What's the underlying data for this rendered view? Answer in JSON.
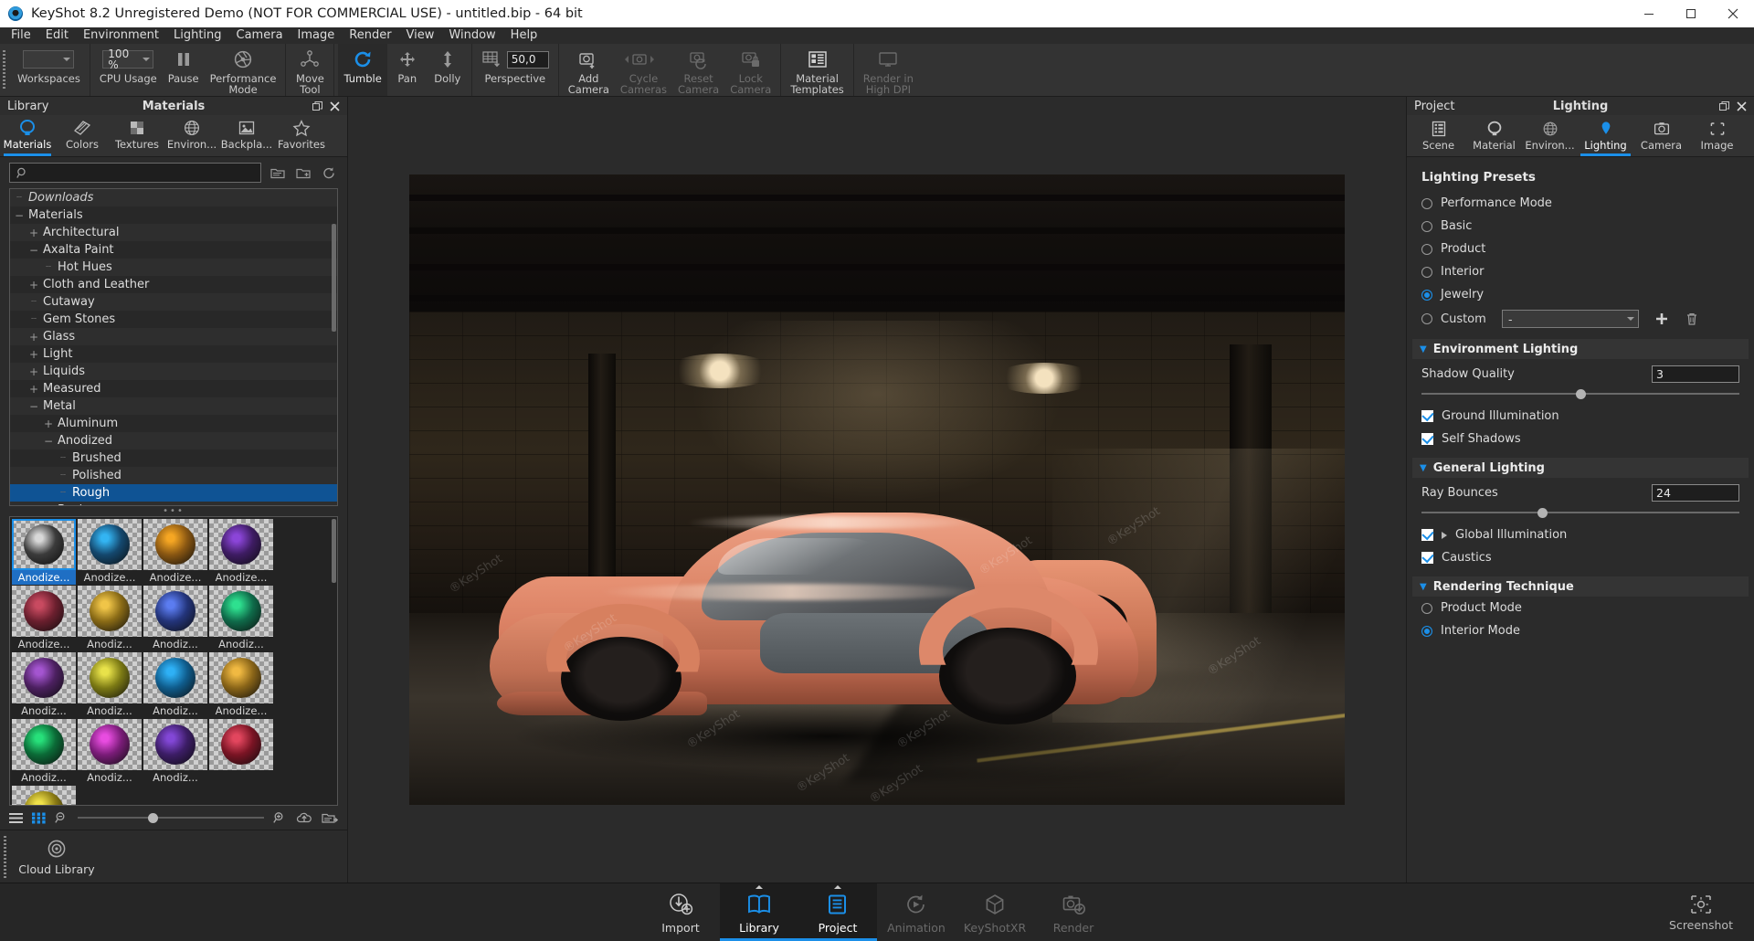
{
  "window": {
    "title": "KeyShot 8.2 Unregistered Demo (NOT FOR COMMERCIAL USE) - untitled.bip  - 64 bit",
    "minimize_label": "Minimize",
    "maximize_label": "Restore",
    "close_label": "Close"
  },
  "menubar": [
    {
      "label": "File"
    },
    {
      "label": "Edit"
    },
    {
      "label": "Environment"
    },
    {
      "label": "Lighting"
    },
    {
      "label": "Camera"
    },
    {
      "label": "Image"
    },
    {
      "label": "Render"
    },
    {
      "label": "View"
    },
    {
      "label": "Window"
    },
    {
      "label": "Help"
    }
  ],
  "ribbon": {
    "workspaces": {
      "label": "Workspaces",
      "value": ""
    },
    "cpu_usage": {
      "label": "CPU Usage",
      "value": "100 %"
    },
    "pause": {
      "label": "Pause"
    },
    "performance_mode": {
      "label": "Performance\nMode"
    },
    "move_tool": {
      "label": "Move\nTool"
    },
    "tumble": {
      "label": "Tumble"
    },
    "pan": {
      "label": "Pan"
    },
    "dolly": {
      "label": "Dolly"
    },
    "perspective": {
      "label": "Perspective",
      "value": "50,0"
    },
    "add_camera": {
      "label": "Add\nCamera"
    },
    "cycle_cameras": {
      "label": "Cycle\nCameras"
    },
    "reset_camera": {
      "label": "Reset\nCamera"
    },
    "lock_camera": {
      "label": "Lock\nCamera"
    },
    "material_templates": {
      "label": "Material\nTemplates"
    },
    "render_in_high_dpi": {
      "label": "Render in\nHigh DPI"
    }
  },
  "library": {
    "header_left": "Library",
    "header_title": "Materials",
    "tabs": [
      {
        "label": "Materials",
        "icon": "materials-icon",
        "active": true
      },
      {
        "label": "Colors",
        "icon": "colors-icon",
        "active": false
      },
      {
        "label": "Textures",
        "icon": "textures-icon",
        "active": false
      },
      {
        "label": "Environ...",
        "icon": "environment-icon",
        "active": false
      },
      {
        "label": "Backpla...",
        "icon": "backplate-icon",
        "active": false
      },
      {
        "label": "Favorites",
        "icon": "star-icon",
        "active": false
      }
    ],
    "search": {
      "placeholder": "",
      "value": ""
    },
    "tree": [
      {
        "label": "Downloads",
        "indent": 1,
        "toggle": "dots",
        "italic": true,
        "selected": false
      },
      {
        "label": "Materials",
        "indent": 0,
        "toggle": "minus",
        "italic": false,
        "selected": false
      },
      {
        "label": "Architectural",
        "indent": 1,
        "toggle": "plus",
        "italic": false,
        "selected": false
      },
      {
        "label": "Axalta Paint",
        "indent": 1,
        "toggle": "minus",
        "italic": false,
        "selected": false
      },
      {
        "label": "Hot Hues",
        "indent": 2,
        "toggle": "dots",
        "italic": false,
        "selected": false
      },
      {
        "label": "Cloth and Leather",
        "indent": 1,
        "toggle": "plus",
        "italic": false,
        "selected": false
      },
      {
        "label": "Cutaway",
        "indent": 1,
        "toggle": "dots",
        "italic": false,
        "selected": false
      },
      {
        "label": "Gem Stones",
        "indent": 1,
        "toggle": "dots",
        "italic": false,
        "selected": false
      },
      {
        "label": "Glass",
        "indent": 1,
        "toggle": "plus",
        "italic": false,
        "selected": false
      },
      {
        "label": "Light",
        "indent": 1,
        "toggle": "plus",
        "italic": false,
        "selected": false
      },
      {
        "label": "Liquids",
        "indent": 1,
        "toggle": "plus",
        "italic": false,
        "selected": false
      },
      {
        "label": "Measured",
        "indent": 1,
        "toggle": "plus",
        "italic": false,
        "selected": false
      },
      {
        "label": "Metal",
        "indent": 1,
        "toggle": "minus",
        "italic": false,
        "selected": false
      },
      {
        "label": "Aluminum",
        "indent": 2,
        "toggle": "plus",
        "italic": false,
        "selected": false
      },
      {
        "label": "Anodized",
        "indent": 2,
        "toggle": "minus",
        "italic": false,
        "selected": false
      },
      {
        "label": "Brushed",
        "indent": 3,
        "toggle": "dots",
        "italic": false,
        "selected": false
      },
      {
        "label": "Polished",
        "indent": 3,
        "toggle": "dots",
        "italic": false,
        "selected": false
      },
      {
        "label": "Rough",
        "indent": 3,
        "toggle": "dots",
        "italic": false,
        "selected": true
      },
      {
        "label": "Basic",
        "indent": 2,
        "toggle": "plus",
        "italic": false,
        "selected": false
      }
    ],
    "thumbnails": [
      {
        "label": "Anodize...",
        "color": "#3b3b3b",
        "hi": "#d8d8d8",
        "selected": true
      },
      {
        "label": "Anodize...",
        "color": "#14486e",
        "hi": "#33b4f2",
        "selected": false
      },
      {
        "label": "Anodize...",
        "color": "#8a5712",
        "hi": "#f5a623",
        "selected": false
      },
      {
        "label": "Anodize...",
        "color": "#3e1c63",
        "hi": "#8b45d8",
        "selected": false
      },
      {
        "label": "Anodize...",
        "color": "#6b1f2e",
        "hi": "#c84a60",
        "selected": false
      },
      {
        "label": "Anodiz...",
        "color": "#8a6b16",
        "hi": "#f0c548",
        "selected": false
      },
      {
        "label": "Anodiz...",
        "color": "#23347a",
        "hi": "#5b7cf0",
        "selected": false
      },
      {
        "label": "Anodiz...",
        "color": "#0f6b4a",
        "hi": "#2ee08f",
        "selected": false
      },
      {
        "label": "Anodiz...",
        "color": "#4c2060",
        "hi": "#a455d0",
        "selected": false
      },
      {
        "label": "Anodiz...",
        "color": "#7c7a14",
        "hi": "#e8e24a",
        "selected": false
      },
      {
        "label": "Anodiz...",
        "color": "#0f5c8c",
        "hi": "#2eb0f5",
        "selected": false
      },
      {
        "label": "Anodize...",
        "color": "#8a6518",
        "hi": "#f0b942",
        "selected": false
      },
      {
        "label": "Anodiz...",
        "color": "#0b6b37",
        "hi": "#27e07a",
        "selected": false
      },
      {
        "label": "Anodiz...",
        "color": "#7a1c78",
        "hi": "#e84ce0",
        "selected": false
      },
      {
        "label": "Anodiz...",
        "color": "#3c1d66",
        "hi": "#8247d6",
        "selected": false
      },
      {
        "label": "",
        "color": "#7a1424",
        "hi": "#e2465e",
        "selected": false
      },
      {
        "label": "",
        "color": "#8a7a14",
        "hi": "#f0e24a",
        "selected": false
      }
    ],
    "footer": {
      "list_view_icon": "list-view-icon",
      "grid_view_icon": "grid-view-icon",
      "zoom_out_icon": "zoom-out-icon",
      "zoom_in_icon": "zoom-in-icon",
      "upload_icon": "cloud-upload-icon",
      "folder_icon": "open-folder-icon",
      "zoom_value": 40
    },
    "cloud_library": {
      "label": "Cloud Library",
      "icon": "cloud-library-icon"
    }
  },
  "viewport": {
    "watermarks": [
      "®KeyShot",
      "®KeyShot",
      "®KeyShot",
      "®KeyShot",
      "®KeyShot",
      "®KeyShot",
      "®KeyShot",
      "®KeyShot",
      "®KeyShot"
    ]
  },
  "project": {
    "header_left": "Project",
    "header_title": "Lighting",
    "tabs": [
      {
        "label": "Scene",
        "icon": "scene-icon",
        "active": false
      },
      {
        "label": "Material",
        "icon": "material-icon",
        "active": false
      },
      {
        "label": "Environ...",
        "icon": "environment-icon",
        "active": false
      },
      {
        "label": "Lighting",
        "icon": "lighting-bulb-icon",
        "active": true
      },
      {
        "label": "Camera",
        "icon": "camera-icon",
        "active": false
      },
      {
        "label": "Image",
        "icon": "image-icon",
        "active": false
      }
    ],
    "lighting_presets": {
      "title": "Lighting Presets",
      "options": [
        {
          "label": "Performance Mode",
          "selected": false
        },
        {
          "label": "Basic",
          "selected": false
        },
        {
          "label": "Product",
          "selected": false
        },
        {
          "label": "Interior",
          "selected": false
        },
        {
          "label": "Jewelry",
          "selected": true
        },
        {
          "label": "Custom",
          "selected": false
        }
      ],
      "custom_combo_value": "-",
      "add_label": "+",
      "delete_label": "delete-icon"
    },
    "environment_lighting": {
      "title": "Environment Lighting",
      "shadow_quality_label": "Shadow Quality",
      "shadow_quality_value": "3",
      "shadow_quality_percent": 50,
      "ground_illumination": {
        "label": "Ground Illumination",
        "checked": true
      },
      "self_shadows": {
        "label": "Self Shadows",
        "checked": true
      }
    },
    "general_lighting": {
      "title": "General Lighting",
      "ray_bounces_label": "Ray Bounces",
      "ray_bounces_value": "24",
      "ray_bounces_percent": 38,
      "global_illumination": {
        "label": "Global Illumination",
        "checked": true
      },
      "caustics": {
        "label": "Caustics",
        "checked": true
      }
    },
    "rendering_technique": {
      "title": "Rendering Technique",
      "options": [
        {
          "label": "Product Mode",
          "selected": false
        },
        {
          "label": "Interior Mode",
          "selected": true
        }
      ]
    }
  },
  "bottombar": {
    "tiles": [
      {
        "label": "Import",
        "icon": "import-icon",
        "active": false,
        "dim": false,
        "pip": false
      },
      {
        "label": "Library",
        "icon": "library-book-icon",
        "active": true,
        "dim": false,
        "pip": true
      },
      {
        "label": "Project",
        "icon": "project-list-icon",
        "active": true,
        "dim": false,
        "pip": true
      },
      {
        "label": "Animation",
        "icon": "animation-icon",
        "active": false,
        "dim": true,
        "pip": false
      },
      {
        "label": "KeyShotXR",
        "icon": "keyshotxr-icon",
        "active": false,
        "dim": true,
        "pip": false
      },
      {
        "label": "Render",
        "icon": "render-camera-icon",
        "active": false,
        "dim": true,
        "pip": false
      }
    ],
    "screenshot": {
      "label": "Screenshot",
      "icon": "screenshot-icon"
    }
  },
  "colors": {
    "accent": "#1b8fe8",
    "panel_bg": "#2b2b2b",
    "selection": "#0f5394",
    "titlebar_bg": "#ffffff"
  }
}
